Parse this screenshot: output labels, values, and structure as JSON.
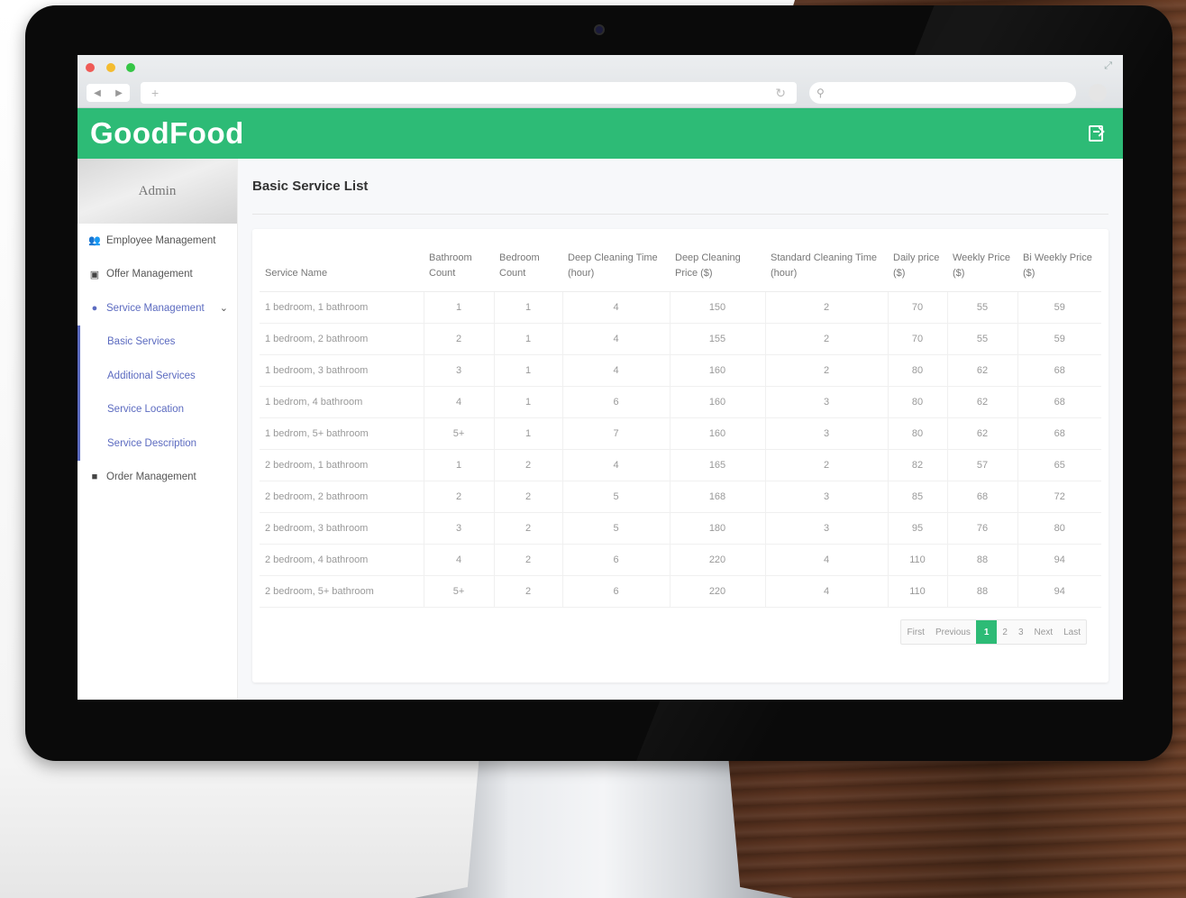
{
  "app": {
    "title": "GoodFood"
  },
  "sidebar": {
    "admin_label": "Admin",
    "items": [
      {
        "label": "Employee Management",
        "icon": "users-icon"
      },
      {
        "label": "Offer Management",
        "icon": "offer-icon"
      },
      {
        "label": "Service Management",
        "icon": "map-pin-icon"
      },
      {
        "label": "Order Management",
        "icon": "briefcase-icon"
      }
    ],
    "service_submenu": [
      "Basic Services",
      "Additional Services",
      "Service Location",
      "Service Description"
    ]
  },
  "main": {
    "title": "Basic Service List",
    "table": {
      "headers": [
        "Service Name",
        "Bathroom Count",
        "Bedroom Count",
        "Deep Cleaning Time (hour)",
        "Deep Cleaning Price ($)",
        "Standard Cleaning Time (hour)",
        "Daily price ($)",
        "Weekly Price ($)",
        "Bi Weekly Price ($)"
      ],
      "rows": [
        [
          "1 bedroom, 1 bathroom",
          "1",
          "1",
          "4",
          "150",
          "2",
          "70",
          "55",
          "59"
        ],
        [
          "1 bedroom, 2 bathroom",
          "2",
          "1",
          "4",
          "155",
          "2",
          "70",
          "55",
          "59"
        ],
        [
          "1 bedroom, 3 bathroom",
          "3",
          "1",
          "4",
          "160",
          "2",
          "80",
          "62",
          "68"
        ],
        [
          "1 bedrom, 4 bathroom",
          "4",
          "1",
          "6",
          "160",
          "3",
          "80",
          "62",
          "68"
        ],
        [
          "1 bedrom, 5+ bathroom",
          "5+",
          "1",
          "7",
          "160",
          "3",
          "80",
          "62",
          "68"
        ],
        [
          "2 bedroom, 1 bathroom",
          "1",
          "2",
          "4",
          "165",
          "2",
          "82",
          "57",
          "65"
        ],
        [
          "2 bedroom, 2 bathroom",
          "2",
          "2",
          "5",
          "168",
          "3",
          "85",
          "68",
          "72"
        ],
        [
          "2 bedroom, 3 bathroom",
          "3",
          "2",
          "5",
          "180",
          "3",
          "95",
          "76",
          "80"
        ],
        [
          "2 bedroom, 4 bathroom",
          "4",
          "2",
          "6",
          "220",
          "4",
          "110",
          "88",
          "94"
        ],
        [
          "2 bedroom, 5+ bathroom",
          "5+",
          "2",
          "6",
          "220",
          "4",
          "110",
          "88",
          "94"
        ]
      ]
    },
    "pagination": {
      "first": "First",
      "previous": "Previous",
      "pages": [
        "1",
        "2",
        "3"
      ],
      "current": "1",
      "next": "Next",
      "last": "Last"
    }
  },
  "colors": {
    "brand": "#2dbb76",
    "accent": "#5c6bc0"
  }
}
